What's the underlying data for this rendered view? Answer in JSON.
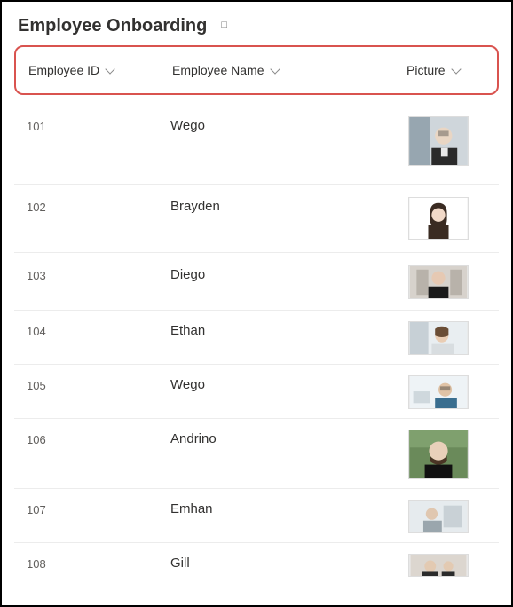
{
  "title": "Employee Onboarding",
  "title_glyph": "□",
  "columns": {
    "id": "Employee ID",
    "name": "Employee Name",
    "picture": "Picture"
  },
  "rows": [
    {
      "id": "101",
      "name": "Wego"
    },
    {
      "id": "102",
      "name": "Brayden"
    },
    {
      "id": "103",
      "name": "Diego"
    },
    {
      "id": "104",
      "name": "Ethan"
    },
    {
      "id": "105",
      "name": "Wego"
    },
    {
      "id": "106",
      "name": "Andrino"
    },
    {
      "id": "107",
      "name": "Emhan"
    },
    {
      "id": "108",
      "name": "Gill"
    }
  ]
}
